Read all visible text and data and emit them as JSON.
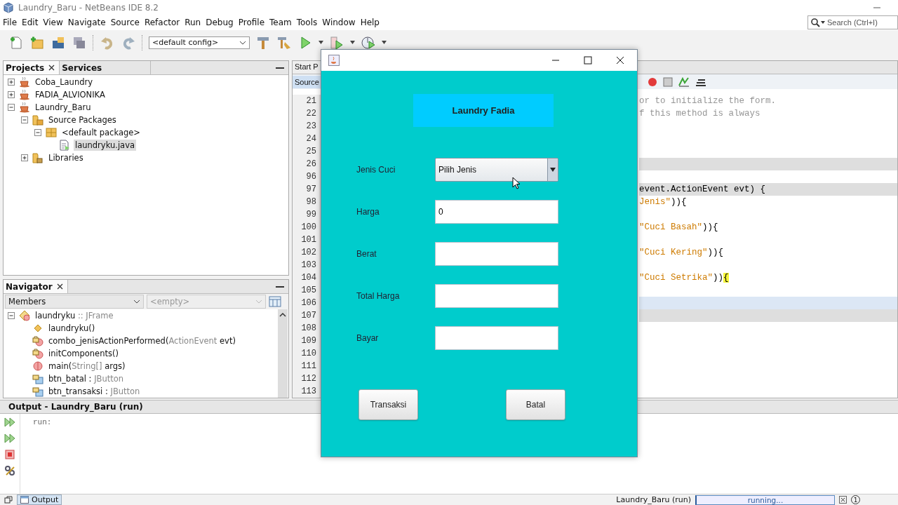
{
  "window": {
    "title": "Laundry_Baru - NetBeans IDE 8.2"
  },
  "menu": [
    "File",
    "Edit",
    "View",
    "Navigate",
    "Source",
    "Refactor",
    "Run",
    "Debug",
    "Profile",
    "Team",
    "Tools",
    "Window",
    "Help"
  ],
  "search": {
    "placeholder": "Search (Ctrl+I)"
  },
  "toolbar": {
    "config": "<default config>"
  },
  "projects_panel": {
    "tabs": [
      {
        "label": "Projects",
        "selected": true
      },
      {
        "label": "Services",
        "selected": false
      }
    ],
    "tree": [
      {
        "label": "Coba_Laundry",
        "kind": "project",
        "expanded": false,
        "selected": false
      },
      {
        "label": "FADIA_ALVIONIKA",
        "kind": "project",
        "expanded": false,
        "selected": false
      },
      {
        "label": "Laundry_Baru",
        "kind": "project",
        "expanded": true,
        "selected": false,
        "children": [
          {
            "label": "Source Packages",
            "kind": "sources",
            "expanded": true,
            "selected": false,
            "children": [
              {
                "label": "<default package>",
                "kind": "package",
                "expanded": true,
                "selected": false,
                "children": [
                  {
                    "label": "laundryku.java",
                    "kind": "file",
                    "selected": true
                  }
                ]
              }
            ]
          },
          {
            "label": "Libraries",
            "kind": "libraries",
            "expanded": false,
            "selected": false
          }
        ]
      }
    ]
  },
  "navigator": {
    "title": "Navigator",
    "filter": "Members",
    "filter_2": "<empty>",
    "root": {
      "parts": [
        {
          "text": "laundryku",
          "muted": false
        },
        {
          "text": " :: JFrame",
          "muted": true
        }
      ],
      "kind": "class",
      "expanded": true
    },
    "members": [
      {
        "kind": "constructor",
        "parts": [
          {
            "text": "laundryku()",
            "muted": false
          }
        ]
      },
      {
        "kind": "private-method",
        "parts": [
          {
            "text": "combo_jenisActionPerformed(",
            "muted": false
          },
          {
            "text": "ActionEvent",
            "muted": true
          },
          {
            "text": " evt)",
            "muted": false
          }
        ]
      },
      {
        "kind": "private-method",
        "parts": [
          {
            "text": "initComponents()",
            "muted": false
          }
        ]
      },
      {
        "kind": "static-method",
        "parts": [
          {
            "text": "main(",
            "muted": false
          },
          {
            "text": "String[]",
            "muted": true
          },
          {
            "text": " args)",
            "muted": false
          }
        ]
      },
      {
        "kind": "field",
        "parts": [
          {
            "text": "btn_batal : ",
            "muted": false
          },
          {
            "text": "JButton",
            "muted": true
          }
        ]
      },
      {
        "kind": "field",
        "parts": [
          {
            "text": "btn_transaksi : ",
            "muted": false
          },
          {
            "text": "JButton",
            "muted": true
          }
        ]
      }
    ]
  },
  "editor": {
    "tabs": [
      {
        "label": "Start P",
        "selected": false
      }
    ],
    "views": [
      {
        "label": "Source",
        "selected": true
      }
    ],
    "lines": [
      {
        "number": "21",
        "guarded": false,
        "current": false,
        "parts": [
          {
            "text": "or to initialize the form.",
            "kind": "comment"
          }
        ]
      },
      {
        "number": "22",
        "guarded": false,
        "current": false,
        "parts": [
          {
            "text": "f this method is always",
            "kind": "comment"
          }
        ]
      },
      {
        "number": "23",
        "guarded": false,
        "current": false
      },
      {
        "number": "24",
        "guarded": false,
        "current": false
      },
      {
        "number": "25",
        "guarded": false,
        "current": false
      },
      {
        "number": "26",
        "guarded": true,
        "current": false
      },
      {
        "number": "96",
        "guarded": false,
        "current": false
      },
      {
        "number": "97",
        "guarded": true,
        "current": false,
        "parts": [
          {
            "text": "event.ActionEvent evt) {",
            "kind": "code"
          }
        ]
      },
      {
        "number": "98",
        "guarded": false,
        "current": false,
        "parts": [
          {
            "text": "Jenis\"",
            "kind": "string"
          },
          {
            "text": ")){",
            "kind": "code"
          }
        ]
      },
      {
        "number": "99",
        "guarded": false,
        "current": false
      },
      {
        "number": "100",
        "guarded": false,
        "current": false,
        "parts": [
          {
            "text": "\"Cuci Basah\"",
            "kind": "string"
          },
          {
            "text": ")){",
            "kind": "code"
          }
        ]
      },
      {
        "number": "101",
        "guarded": false,
        "current": false
      },
      {
        "number": "102",
        "guarded": false,
        "current": false,
        "parts": [
          {
            "text": "\"Cuci Kering\"",
            "kind": "string"
          },
          {
            "text": ")){",
            "kind": "code"
          }
        ]
      },
      {
        "number": "103",
        "guarded": false,
        "current": false
      },
      {
        "number": "104",
        "guarded": false,
        "current": false,
        "parts": [
          {
            "text": "\"Cuci Setrika\"",
            "kind": "string"
          },
          {
            "text": "))",
            "kind": "code"
          },
          {
            "text": "{",
            "kind": "matched-brace"
          }
        ]
      },
      {
        "number": "105",
        "guarded": false,
        "current": false
      },
      {
        "number": "106",
        "guarded": false,
        "current": true
      },
      {
        "number": "107",
        "guarded": true,
        "current": false
      },
      {
        "number": "108",
        "guarded": false,
        "current": false
      },
      {
        "number": "109",
        "guarded": false,
        "current": false
      },
      {
        "number": "110",
        "guarded": false,
        "current": false
      },
      {
        "number": "111",
        "guarded": false,
        "current": false
      },
      {
        "number": "112",
        "guarded": false,
        "current": false
      },
      {
        "number": "113",
        "guarded": false,
        "current": false
      }
    ]
  },
  "output": {
    "title": "Output - Laundry_Baru (run)",
    "lines": [
      "run:"
    ]
  },
  "status_bar": {
    "tab": "Output",
    "task": "Laundry_Baru (run)",
    "progress": "running...",
    "notifications": "1"
  },
  "dialog": {
    "heading": "Laundry Fadia",
    "fields": [
      {
        "label": "Jenis Cuci",
        "kind": "combo",
        "value": "Pilih Jenis"
      },
      {
        "label": "Harga",
        "kind": "text",
        "value": "0"
      },
      {
        "label": "Berat",
        "kind": "text"
      },
      {
        "label": "Total Harga",
        "kind": "text"
      },
      {
        "label": "Bayar",
        "kind": "text"
      }
    ],
    "buttons": [
      "Transaksi",
      "Batal"
    ]
  }
}
